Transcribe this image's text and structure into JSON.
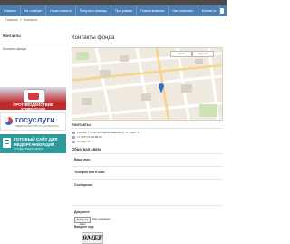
{
  "nav": {
    "items": [
      {
        "label": "Главная"
      },
      {
        "label": "На главную"
      },
      {
        "label": "Наши новости"
      },
      {
        "label": "Получить помощь"
      },
      {
        "label": "Программы"
      },
      {
        "label": "Пожертвования"
      },
      {
        "label": "Нас помогают"
      },
      {
        "label": "Контакты"
      }
    ]
  },
  "breadcrumb": {
    "home": "Главная",
    "separator": "»",
    "current": "Контакты"
  },
  "sidebar": {
    "title": "Контакты",
    "subtitle": "Контакты фонда",
    "banner1_text": "ПРОТИВОДЕЙСТВИЕ КОРРУПЦИИ",
    "banner2_title": "госуслуги",
    "banner2_sub": "ФЕДЕРАЛЬНЫЙ ПОРТАЛ GOSUSLUGI.RU",
    "banner3_line1": "ГОТОВЫЙ САЙТ ДЛЯ",
    "banner3_line2": "МЕДОРГАНИЗАЦИИ",
    "banner3_line3": "ЛУЧШЕЕ ПРЕДЛОЖЕНИЕ"
  },
  "main": {
    "title": "Контакты фонда",
    "map_btn_left": "Схема",
    "map_btn_right": "Спутник",
    "contacts_heading": "Контакты",
    "address": "165500, г. Ухта, ул. Карла Маркса, д. 37, корп. 1",
    "phone": "+7 (347) 2-88-88-88",
    "email": "fond@mail.ru",
    "form_title": "Обратная связь",
    "field_name": "Ваше имя:",
    "field_phone": "Телефон или E-mail:",
    "field_message": "Сообщение:",
    "field_file": "Документ:",
    "file_button": "Выберите файл",
    "file_status": "Файл не выбран",
    "captcha_label": "Введите код:",
    "captcha_code": "9MEF"
  },
  "colors": {
    "nav_bg": "#4d7fb3",
    "banner1_red": "#c02a2a",
    "gosuslugi_blue": "#3a5ba8",
    "banner3_teal": "#2f9a9c"
  }
}
